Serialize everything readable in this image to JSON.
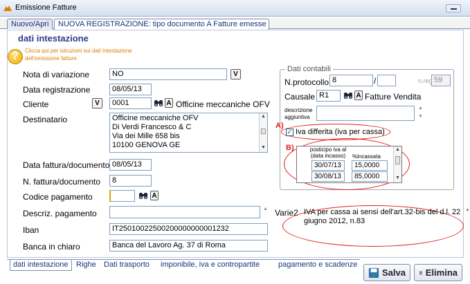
{
  "window": {
    "title": "Emissione Fatture"
  },
  "tabs_top": [
    "Nuovo/Apri",
    "NUOVA REGISTRAZIONE: tipo documento A Fatture emesse"
  ],
  "section": {
    "title": "dati intestazione",
    "help_text": "Clicca qui per istruzioni sui dati intestazione dell'emissione fatture"
  },
  "form": {
    "nota_variazione": {
      "label": "Nota di variazione",
      "value": "NO"
    },
    "data_registrazione": {
      "label": "Data registrazione",
      "value": "08/05/13"
    },
    "cliente": {
      "label": "Cliente",
      "code": "0001",
      "name": "Officine meccaniche OFV",
      "a_button": "A"
    },
    "destinatario": {
      "label": "Destinatario",
      "lines": [
        "Officine meccaniche OFV",
        "Di Verdi Francesco & C",
        "Via dei Mille 658 bis",
        "10100 GENOVA GE"
      ]
    },
    "data_fattura": {
      "label": "Data fattura/documento",
      "value": "08/05/13"
    },
    "n_fattura": {
      "label": "N. fattura/documento",
      "value": "8"
    },
    "codice_pagamento": {
      "label": "Codice pagamento",
      "value": "",
      "a_button": "A"
    },
    "descriz_pagamento": {
      "label": "Descriz. pagamento",
      "value": ""
    },
    "iban": {
      "label": "Iban",
      "value": "IT25010022500200000000001232"
    },
    "banca": {
      "label": "Banca in chiaro",
      "value": "Banca del Lavoro Ag. 37 di Roma"
    }
  },
  "dati_contabili": {
    "title": "Dati contabili",
    "n_protocollo": {
      "label": "N.protocollo",
      "value": "8",
      "sep": "/",
      "suffix": ""
    },
    "nreg": {
      "label": "n.reg",
      "value": "59"
    },
    "causale": {
      "label": "Causale",
      "code": "R1",
      "a_button": "A",
      "desc": "Fatture Vendita"
    },
    "descrizione_agg": {
      "label_line1": "descrizione",
      "label_line2": "aggiuntiva",
      "value": ""
    },
    "marker_a": "A)",
    "iva_differita": {
      "label": "Iva differita (iva per cassa)",
      "checked": true
    },
    "marker_b": "B)",
    "posticipo_table": {
      "headers": [
        "posticipo iva al (data incasso)",
        "%incassata"
      ],
      "rows": [
        [
          "30/07/13",
          "15,0000"
        ],
        [
          "30/08/13",
          "85,0000"
        ]
      ]
    }
  },
  "varie": {
    "label": "Varie2",
    "text": "IVA per cassa ai sensi dell'art.32-bis del d.l. 22 giugno 2012, n.83"
  },
  "tabs_bottom": [
    "dati intestazione",
    "Righe",
    "Dati trasporto",
    "imponibile, iva e contropartite",
    "pagamento e scadenze"
  ],
  "buttons": {
    "save": "Salva",
    "delete": "Elimina",
    "dropdown_glyph": "V"
  },
  "colors": {
    "accent_red": "#e21c1c",
    "title_blue": "#2b3a8c",
    "help_orange": "#e07c00"
  }
}
